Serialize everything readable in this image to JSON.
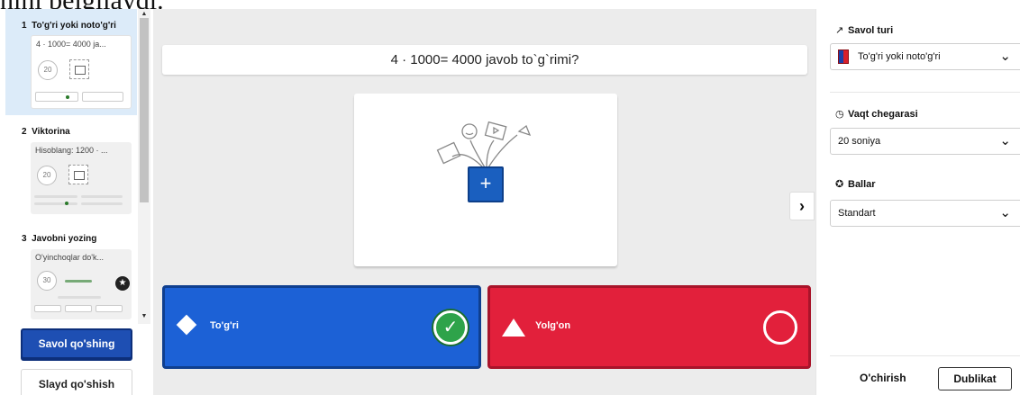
{
  "caption": "nini belgilaydi.",
  "slides": [
    {
      "number": "1",
      "type": "To'g'ri yoki noto'g'ri",
      "preview": "4 · 1000= 4000 ja...",
      "time": "20"
    },
    {
      "number": "2",
      "type": "Viktorina",
      "preview": "Hisoblang: 1200 · ...",
      "time": "20"
    },
    {
      "number": "3",
      "type": "Javobni yozing",
      "preview": "O'yinchoqlar do'k...",
      "time": "30"
    }
  ],
  "left_buttons": {
    "add_question": "Savol qo'shing",
    "add_slide": "Slayd qo'shish"
  },
  "editor": {
    "question": "4 · 1000= 4000 javob to`g`rimi?",
    "answers": [
      {
        "label": "To'g'ri",
        "color": "#1c61d6",
        "correct": true
      },
      {
        "label": "Yolg'on",
        "color": "#e2203b",
        "correct": false
      }
    ]
  },
  "settings": {
    "question_type": {
      "label": "Savol turi",
      "value": "To'g'ri yoki noto'g'ri"
    },
    "time_limit": {
      "label": "Vaqt chegarasi",
      "value": "20 soniya"
    },
    "points": {
      "label": "Ballar",
      "value": "Standart"
    },
    "delete_label": "O'chirish",
    "duplicate_label": "Dublikat"
  },
  "icons": [
    "duplicate-icon",
    "trash-icon",
    "image-icon",
    "star-icon",
    "plus-icon",
    "chevron-right-icon",
    "chevron-down-icon",
    "clock-icon",
    "medal-icon",
    "question-type-icon",
    "check-icon"
  ]
}
